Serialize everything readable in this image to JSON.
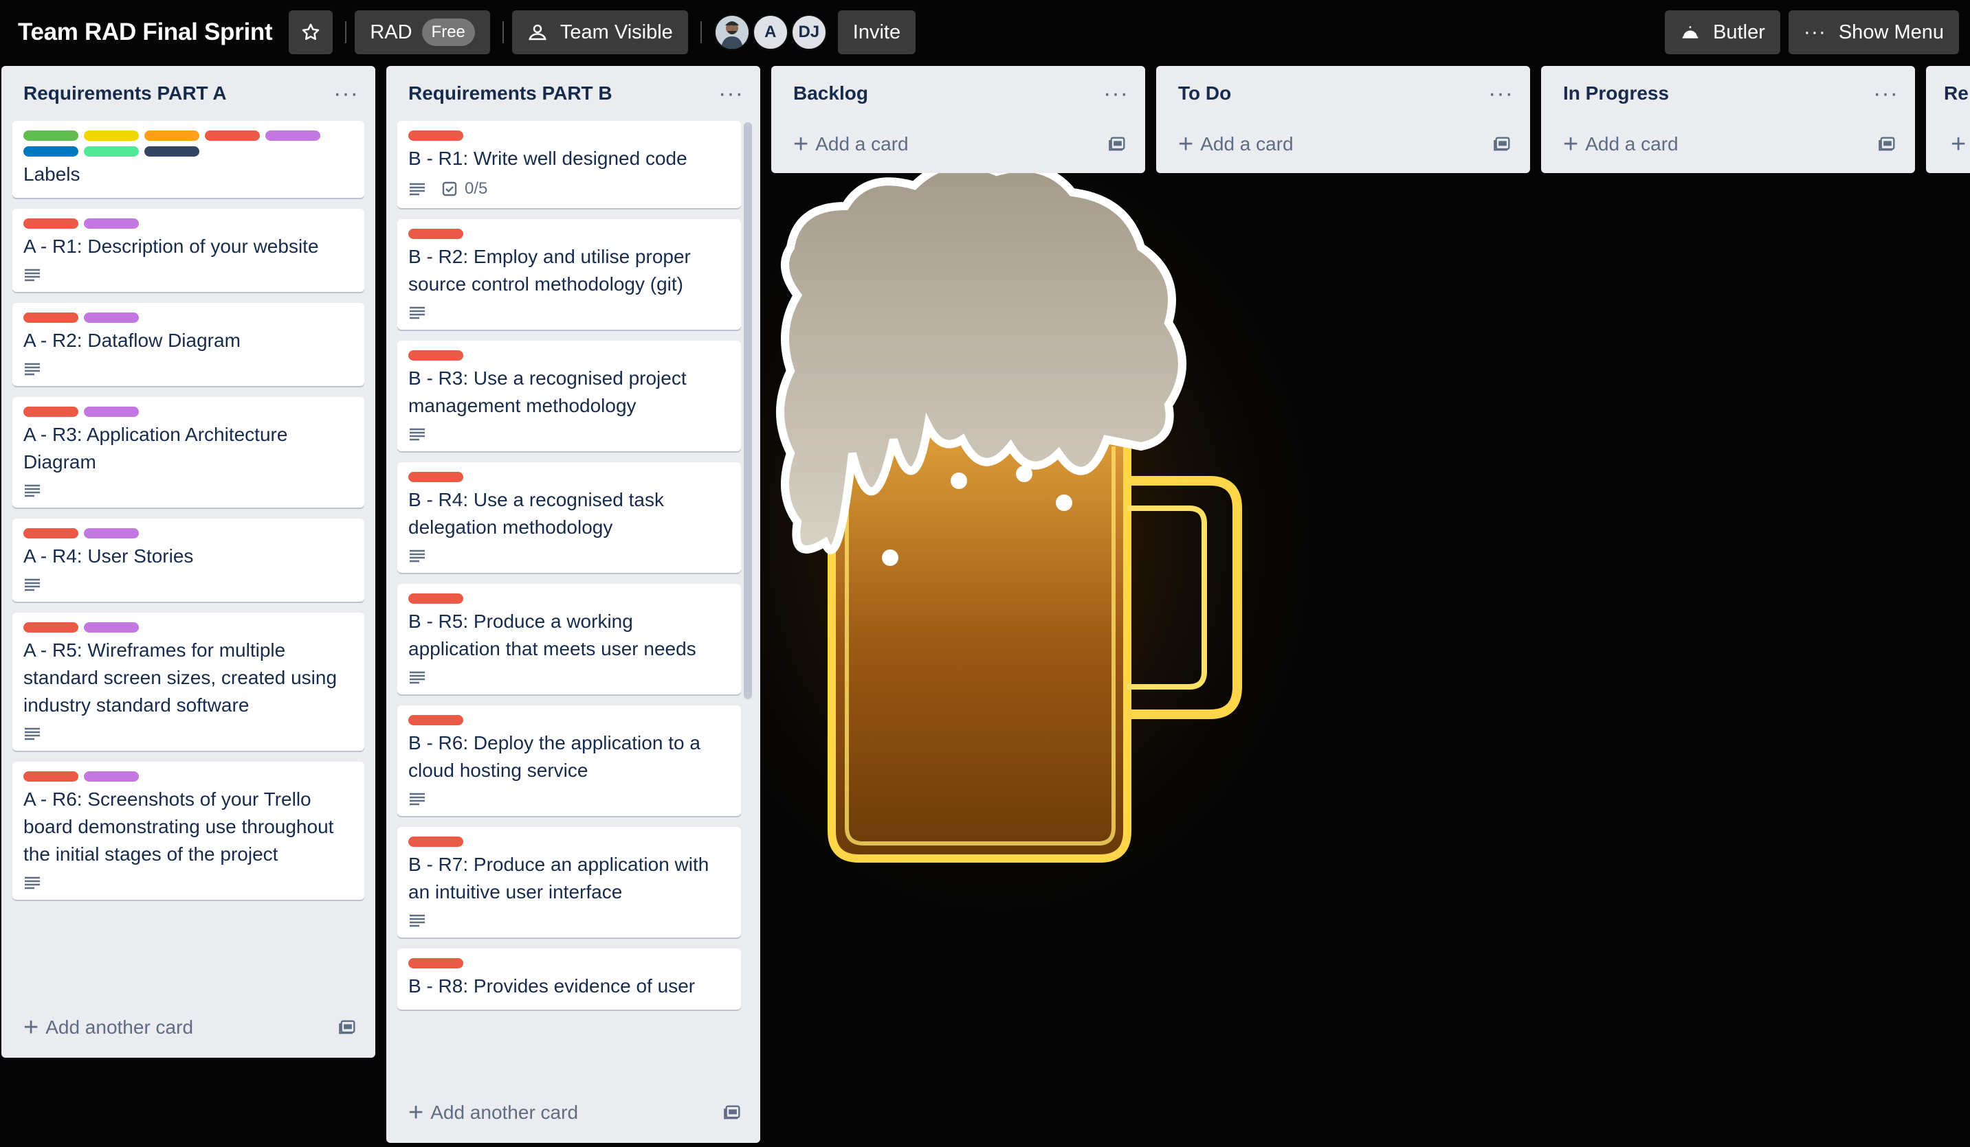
{
  "header": {
    "board_title": "Team RAD Final Sprint",
    "team_name": "RAD",
    "plan_badge": "Free",
    "visibility_label": "Team Visible",
    "members": [
      {
        "initials": ""
      },
      {
        "initials": "A"
      },
      {
        "initials": "DJ"
      }
    ],
    "invite_label": "Invite",
    "butler_label": "Butler",
    "show_menu_label": "Show Menu"
  },
  "colors": {
    "green": "#61bd4f",
    "yellow": "#f2d600",
    "orange": "#ff9f1a",
    "red": "#eb5a46",
    "purple": "#c377e0",
    "blue": "#0079bf",
    "lime": "#51e898",
    "black": "#344563"
  },
  "lists": [
    {
      "title": "Requirements PART A",
      "add_label": "Add another card",
      "cards": [
        {
          "labels": [
            "green",
            "yellow",
            "orange",
            "red",
            "purple",
            "blue",
            "lime",
            "black"
          ],
          "title": "Labels",
          "has_description": false
        },
        {
          "labels": [
            "red",
            "purple"
          ],
          "title": "A - R1: Description of your website",
          "has_description": true
        },
        {
          "labels": [
            "red",
            "purple"
          ],
          "title": "A - R2: Dataflow Diagram",
          "has_description": true
        },
        {
          "labels": [
            "red",
            "purple"
          ],
          "title": "A - R3: Application Architecture Diagram",
          "has_description": true
        },
        {
          "labels": [
            "red",
            "purple"
          ],
          "title": "A - R4: User Stories",
          "has_description": true
        },
        {
          "labels": [
            "red",
            "purple"
          ],
          "title": "A - R5: Wireframes for multiple standard screen sizes, created using industry standard software",
          "has_description": true
        },
        {
          "labels": [
            "red",
            "purple"
          ],
          "title": "A - R6: Screenshots of your Trello board demonstrating use throughout the initial stages of the project",
          "has_description": true
        }
      ]
    },
    {
      "title": "Requirements PART B",
      "add_label": "Add another card",
      "cards": [
        {
          "labels": [
            "red"
          ],
          "title": "B - R1: Write well designed code",
          "has_description": true,
          "checklist": "0/5"
        },
        {
          "labels": [
            "red"
          ],
          "title": "B - R2: Employ and utilise proper source control methodology (git)",
          "has_description": true
        },
        {
          "labels": [
            "red"
          ],
          "title": "B - R3: Use a recognised project management methodology",
          "has_description": true
        },
        {
          "labels": [
            "red"
          ],
          "title": "B - R4: Use a recognised task delegation methodology",
          "has_description": true
        },
        {
          "labels": [
            "red"
          ],
          "title": "B - R5: Produce a working application that meets user needs",
          "has_description": true
        },
        {
          "labels": [
            "red"
          ],
          "title": "B - R6: Deploy the application to a cloud hosting service",
          "has_description": true
        },
        {
          "labels": [
            "red"
          ],
          "title": "B - R7: Produce an application with an intuitive user interface",
          "has_description": true
        },
        {
          "labels": [
            "red"
          ],
          "title": "B - R8: Provides evidence of user",
          "has_description": false
        }
      ]
    },
    {
      "title": "Backlog",
      "add_label": "Add a card",
      "cards": []
    },
    {
      "title": "To Do",
      "add_label": "Add a card",
      "cards": []
    },
    {
      "title": "In Progress",
      "add_label": "Add a card",
      "cards": []
    },
    {
      "title": "Re",
      "add_label": "",
      "cards": []
    }
  ]
}
